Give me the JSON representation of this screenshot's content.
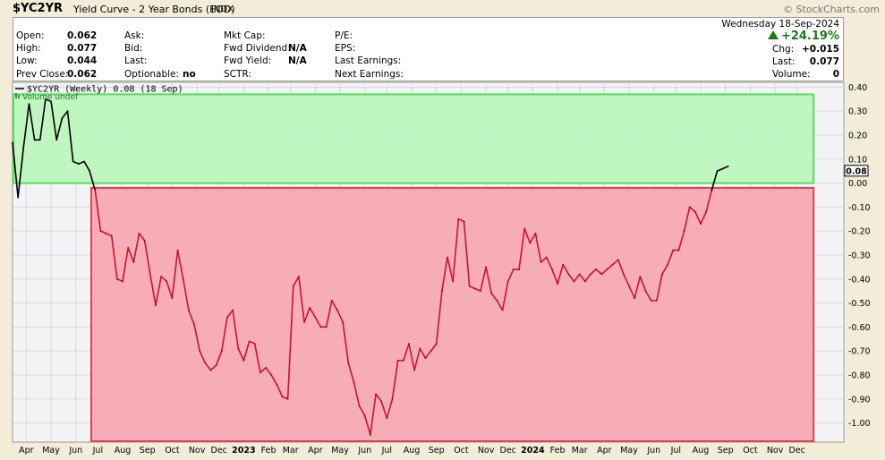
{
  "header": {
    "symbol": "$YC2YR",
    "name": "Yield Curve - 2 Year Bonds (EOD)",
    "exchange": "INDX",
    "brand": "© StockCharts.com"
  },
  "info": {
    "left": [
      {
        "label": "Open:",
        "value": "0.062"
      },
      {
        "label": "High:",
        "value": "0.077"
      },
      {
        "label": "Low:",
        "value": "0.044"
      },
      {
        "label": "Prev Close:",
        "value": "0.062"
      }
    ],
    "mid1": [
      {
        "label": "Ask:",
        "value": ""
      },
      {
        "label": "Bid:",
        "value": ""
      },
      {
        "label": "Last:",
        "value": ""
      },
      {
        "label": "Optionable:",
        "value": "no"
      }
    ],
    "mid2": [
      {
        "label": "Mkt Cap:",
        "value": ""
      },
      {
        "label": "Fwd Dividend:",
        "value": "N/A"
      },
      {
        "label": "Fwd Yield:",
        "value": "N/A"
      },
      {
        "label": "SCTR:",
        "value": ""
      }
    ],
    "mid3": [
      {
        "label": "P/E:",
        "value": ""
      },
      {
        "label": "EPS:",
        "value": ""
      },
      {
        "label": "Last Earnings:",
        "value": ""
      },
      {
        "label": "Next Earnings:",
        "value": ""
      }
    ],
    "date": "Wednesday  18-Sep-2024",
    "pct_change": "+24.19%",
    "right": [
      {
        "label": "Chg:",
        "value": "+0.015"
      },
      {
        "label": "Last:",
        "value": "0.077"
      },
      {
        "label": "Volume:",
        "value": "0"
      }
    ]
  },
  "colors": {
    "line": "#000000",
    "line_neg": "#cc1133",
    "green_zone": "#bdf5bd",
    "green_border": "#55dd55",
    "red_zone": "#f7a9b3",
    "red_border": "#e04050",
    "up": "#1a7a1a"
  },
  "chart_data": {
    "type": "line",
    "legend": "$YC2YR (Weekly) 0.08 (18 Sep)",
    "volume_note": "Volume undef",
    "last_label": "0.08",
    "ylim": [
      -1.08,
      0.42
    ],
    "yticks": [
      0.4,
      0.3,
      0.2,
      0.1,
      0.0,
      -0.1,
      -0.2,
      -0.3,
      -0.4,
      -0.5,
      -0.6,
      -0.7,
      -0.8,
      -0.9,
      -1.0
    ],
    "ytick_labels": [
      "0.40",
      "0.30",
      "0.20",
      "0.10",
      "0.00",
      "-0.10",
      "-0.20",
      "-0.30",
      "-0.40",
      "-0.50",
      "-0.60",
      "-0.70",
      "-0.80",
      "-0.90",
      "-1.00"
    ],
    "x_domain_weeks": [
      0,
      151
    ],
    "x_ticks": [
      {
        "label": "Apr",
        "w": 2.5,
        "bold": false
      },
      {
        "label": "May",
        "w": 7,
        "bold": false
      },
      {
        "label": "Jun",
        "w": 11.5,
        "bold": false
      },
      {
        "label": "Jul",
        "w": 15.5,
        "bold": false
      },
      {
        "label": "Aug",
        "w": 20,
        "bold": false
      },
      {
        "label": "Sep",
        "w": 24.5,
        "bold": false
      },
      {
        "label": "Oct",
        "w": 29,
        "bold": false
      },
      {
        "label": "Nov",
        "w": 33.5,
        "bold": false
      },
      {
        "label": "Dec",
        "w": 37.5,
        "bold": false
      },
      {
        "label": "2023",
        "w": 42,
        "bold": true
      },
      {
        "label": "Feb",
        "w": 46.5,
        "bold": false
      },
      {
        "label": "Mar",
        "w": 50.5,
        "bold": false
      },
      {
        "label": "Apr",
        "w": 55,
        "bold": false
      },
      {
        "label": "May",
        "w": 59.5,
        "bold": false
      },
      {
        "label": "Jun",
        "w": 64,
        "bold": false
      },
      {
        "label": "Jul",
        "w": 68,
        "bold": false
      },
      {
        "label": "Aug",
        "w": 72.5,
        "bold": false
      },
      {
        "label": "Sep",
        "w": 77,
        "bold": false
      },
      {
        "label": "Oct",
        "w": 81.5,
        "bold": false
      },
      {
        "label": "Nov",
        "w": 86,
        "bold": false
      },
      {
        "label": "Dec",
        "w": 90,
        "bold": false
      },
      {
        "label": "2024",
        "w": 94.5,
        "bold": true
      },
      {
        "label": "Feb",
        "w": 99,
        "bold": false
      },
      {
        "label": "Mar",
        "w": 103,
        "bold": false
      },
      {
        "label": "Apr",
        "w": 107.5,
        "bold": false
      },
      {
        "label": "May",
        "w": 112,
        "bold": false
      },
      {
        "label": "Jun",
        "w": 116.5,
        "bold": false
      },
      {
        "label": "Jul",
        "w": 120.5,
        "bold": false
      },
      {
        "label": "Aug",
        "w": 125,
        "bold": false
      },
      {
        "label": "Sep",
        "w": 129.5,
        "bold": false
      },
      {
        "label": "Oct",
        "w": 134,
        "bold": false
      },
      {
        "label": "Nov",
        "w": 138.5,
        "bold": false
      },
      {
        "label": "Dec",
        "w": 142.5,
        "bold": false
      }
    ],
    "zones": [
      {
        "name": "positive",
        "w0": 0,
        "w1": 145.5,
        "y0": 0.0,
        "y1": 0.37
      },
      {
        "name": "negative",
        "w0": 14.3,
        "w1": 145.5,
        "y0": -1.08,
        "y1": -0.02
      }
    ],
    "series": [
      {
        "points": [
          [
            0,
            0.17
          ],
          [
            1,
            -0.06
          ],
          [
            2,
            0.15
          ],
          [
            3,
            0.33
          ],
          [
            4,
            0.18
          ],
          [
            5,
            0.18
          ],
          [
            6,
            0.35
          ],
          [
            7,
            0.34
          ],
          [
            8,
            0.18
          ],
          [
            9,
            0.27
          ],
          [
            10,
            0.3
          ],
          [
            11,
            0.09
          ],
          [
            12,
            0.08
          ],
          [
            13,
            0.09
          ],
          [
            14,
            0.05
          ],
          [
            15,
            -0.03
          ],
          [
            16,
            -0.2
          ],
          [
            17,
            -0.21
          ],
          [
            18,
            -0.22
          ],
          [
            19,
            -0.4
          ],
          [
            20,
            -0.41
          ],
          [
            21,
            -0.27
          ],
          [
            22,
            -0.33
          ],
          [
            23,
            -0.21
          ],
          [
            24,
            -0.24
          ],
          [
            25,
            -0.38
          ],
          [
            26,
            -0.51
          ],
          [
            27,
            -0.39
          ],
          [
            28,
            -0.41
          ],
          [
            29,
            -0.48
          ],
          [
            30,
            -0.28
          ],
          [
            31,
            -0.4
          ],
          [
            32,
            -0.53
          ],
          [
            33,
            -0.59
          ],
          [
            34,
            -0.7
          ],
          [
            35,
            -0.75
          ],
          [
            36,
            -0.78
          ],
          [
            37,
            -0.76
          ],
          [
            38,
            -0.7
          ],
          [
            39,
            -0.56
          ],
          [
            40,
            -0.53
          ],
          [
            41,
            -0.69
          ],
          [
            42,
            -0.74
          ],
          [
            43,
            -0.66
          ],
          [
            44,
            -0.67
          ],
          [
            45,
            -0.79
          ],
          [
            46,
            -0.77
          ],
          [
            47,
            -0.8
          ],
          [
            48,
            -0.84
          ],
          [
            49,
            -0.89
          ],
          [
            50,
            -0.9
          ],
          [
            51,
            -0.43
          ],
          [
            52,
            -0.39
          ],
          [
            53,
            -0.58
          ],
          [
            54,
            -0.52
          ],
          [
            55,
            -0.56
          ],
          [
            56,
            -0.6
          ],
          [
            57,
            -0.6
          ],
          [
            58,
            -0.49
          ],
          [
            59,
            -0.53
          ],
          [
            60,
            -0.58
          ],
          [
            61,
            -0.75
          ],
          [
            62,
            -0.83
          ],
          [
            63,
            -0.93
          ],
          [
            64,
            -0.97
          ],
          [
            65,
            -1.05
          ],
          [
            66,
            -0.88
          ],
          [
            67,
            -0.91
          ],
          [
            68,
            -0.98
          ],
          [
            69,
            -0.9
          ],
          [
            70,
            -0.74
          ],
          [
            71,
            -0.74
          ],
          [
            72,
            -0.67
          ],
          [
            73,
            -0.78
          ],
          [
            74,
            -0.69
          ],
          [
            75,
            -0.73
          ],
          [
            76,
            -0.7
          ],
          [
            77,
            -0.67
          ],
          [
            78,
            -0.45
          ],
          [
            79,
            -0.31
          ],
          [
            80,
            -0.41
          ],
          [
            81,
            -0.15
          ],
          [
            82,
            -0.16
          ],
          [
            83,
            -0.43
          ],
          [
            84,
            -0.44
          ],
          [
            85,
            -0.45
          ],
          [
            86,
            -0.35
          ],
          [
            87,
            -0.46
          ],
          [
            88,
            -0.49
          ],
          [
            89,
            -0.53
          ],
          [
            90,
            -0.41
          ],
          [
            91,
            -0.36
          ],
          [
            92,
            -0.36
          ],
          [
            93,
            -0.19
          ],
          [
            94,
            -0.25
          ],
          [
            95,
            -0.21
          ],
          [
            96,
            -0.33
          ],
          [
            97,
            -0.31
          ],
          [
            98,
            -0.36
          ],
          [
            99,
            -0.42
          ],
          [
            100,
            -0.34
          ],
          [
            101,
            -0.38
          ],
          [
            102,
            -0.41
          ],
          [
            103,
            -0.38
          ],
          [
            104,
            -0.41
          ],
          [
            105,
            -0.38
          ],
          [
            106,
            -0.36
          ],
          [
            107,
            -0.38
          ],
          [
            108,
            -0.36
          ],
          [
            109,
            -0.34
          ],
          [
            110,
            -0.32
          ],
          [
            111,
            -0.38
          ],
          [
            112,
            -0.43
          ],
          [
            113,
            -0.48
          ],
          [
            114,
            -0.39
          ],
          [
            115,
            -0.45
          ],
          [
            116,
            -0.49
          ],
          [
            117,
            -0.49
          ],
          [
            118,
            -0.38
          ],
          [
            119,
            -0.34
          ],
          [
            120,
            -0.28
          ],
          [
            121,
            -0.28
          ],
          [
            122,
            -0.2
          ],
          [
            123,
            -0.1
          ],
          [
            124,
            -0.12
          ],
          [
            125,
            -0.17
          ],
          [
            126,
            -0.12
          ],
          [
            127,
            -0.03
          ],
          [
            128,
            0.05
          ],
          [
            129,
            0.06
          ],
          [
            130,
            0.07
          ]
        ]
      }
    ]
  }
}
